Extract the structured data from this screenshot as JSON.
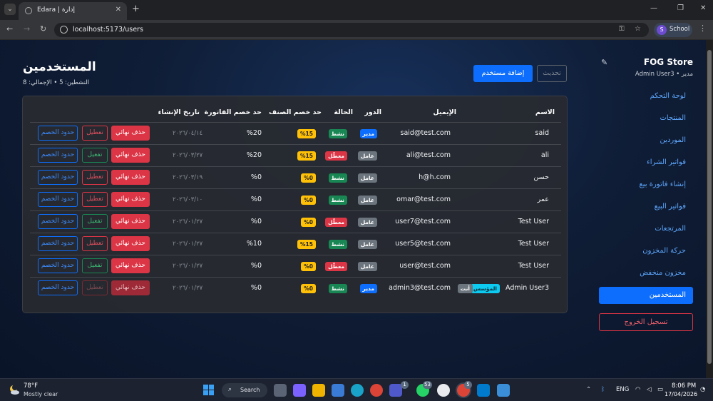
{
  "browser": {
    "tab_title": "Edara | إدارة",
    "url": "localhost:5173/users",
    "profile_name": "School",
    "profile_initial": "S"
  },
  "sidebar": {
    "store_name": "FOG Store",
    "admin_line": "Admin User3 • مدير",
    "items": [
      {
        "label": "لوحة التحكم",
        "active": false
      },
      {
        "label": "المنتجات",
        "active": false
      },
      {
        "label": "الموردين",
        "active": false
      },
      {
        "label": "فواتير الشراء",
        "active": false
      },
      {
        "label": "إنشاء فاتورة بيع",
        "active": false
      },
      {
        "label": "فواتير البيع",
        "active": false
      },
      {
        "label": "المرتجعات",
        "active": false
      },
      {
        "label": "حركة المخزون",
        "active": false
      },
      {
        "label": "مخزون منخفض",
        "active": false
      },
      {
        "label": "المستخدمين",
        "active": true
      }
    ],
    "logout_label": "تسجيل الخروج"
  },
  "header": {
    "title": "المستخدمين",
    "subtitle": "النشطين: 5 • الإجمالي: 8",
    "refresh_label": "تحديث",
    "add_user_label": "إضافة مستخدم"
  },
  "table": {
    "columns": {
      "name": "الاسم",
      "email": "الإيميل",
      "role": "الدور",
      "status": "الحالة",
      "item_discount": "حد خصم الصنف",
      "invoice_discount": "حد خصم الفاتورة",
      "created_at": "تاريخ الإنشاء"
    },
    "actions": {
      "delete": "حذف نهائي",
      "disable": "تعطيل",
      "enable": "تفعيل",
      "limits": "حدود الخصم"
    },
    "rows": [
      {
        "name": "said",
        "email": "said@test.com",
        "role": "مدير",
        "role_type": "admin",
        "status": "نشط",
        "active": true,
        "item_discount": "%15",
        "invoice_discount": "%20",
        "created_at": "٢٠٢٦/٠٤/١٤",
        "founder": "",
        "you": ""
      },
      {
        "name": "ali",
        "email": "ali@test.com",
        "role": "عامل",
        "role_type": "worker",
        "status": "معطّل",
        "active": false,
        "item_discount": "%15",
        "invoice_discount": "%20",
        "created_at": "٢٠٢٦/٠٣/٢٧",
        "founder": "",
        "you": ""
      },
      {
        "name": "حسن",
        "email": "h@h.com",
        "role": "عامل",
        "role_type": "worker",
        "status": "نشط",
        "active": true,
        "item_discount": "%0",
        "invoice_discount": "%0",
        "created_at": "٢٠٢٦/٠٣/١٩",
        "founder": "",
        "you": ""
      },
      {
        "name": "عمر",
        "email": "omar@test.com",
        "role": "عامل",
        "role_type": "worker",
        "status": "نشط",
        "active": true,
        "item_discount": "%0",
        "invoice_discount": "%0",
        "created_at": "٢٠٢٦/٠٣/١٠",
        "founder": "",
        "you": ""
      },
      {
        "name": "Test User",
        "email": "user7@test.com",
        "role": "عامل",
        "role_type": "worker",
        "status": "معطّل",
        "active": false,
        "item_discount": "%0",
        "invoice_discount": "%0",
        "created_at": "٢٠٢٦/٠١/٢٧",
        "founder": "",
        "you": ""
      },
      {
        "name": "Test User",
        "email": "user5@test.com",
        "role": "عامل",
        "role_type": "worker",
        "status": "نشط",
        "active": true,
        "item_discount": "%15",
        "invoice_discount": "%10",
        "created_at": "٢٠٢٦/٠١/٢٧",
        "founder": "",
        "you": ""
      },
      {
        "name": "Test User",
        "email": "user@test.com",
        "role": "عامل",
        "role_type": "worker",
        "status": "معطّل",
        "active": false,
        "item_discount": "%0",
        "invoice_discount": "%0",
        "created_at": "٢٠٢٦/٠١/٢٧",
        "founder": "",
        "you": ""
      },
      {
        "name": "Admin User3",
        "email": "admin3@test.com",
        "role": "مدير",
        "role_type": "admin",
        "status": "نشط",
        "active": true,
        "item_discount": "%0",
        "invoice_discount": "%0",
        "created_at": "٢٠٢٦/٠١/٢٧",
        "founder": "المؤسس",
        "you": "أنت"
      }
    ]
  },
  "taskbar": {
    "weather_temp": "78°F",
    "weather_desc": "Mostly clear",
    "search_label": "Search",
    "language": "ENG",
    "time": "8:06 PM",
    "date": "17/04/2026",
    "badges": [
      "1",
      "53",
      "5"
    ]
  },
  "colors": {
    "primary": "#0d6efd",
    "danger": "#dc3545",
    "success": "#198754",
    "warning": "#ffc107",
    "info": "#0dcaf0"
  }
}
